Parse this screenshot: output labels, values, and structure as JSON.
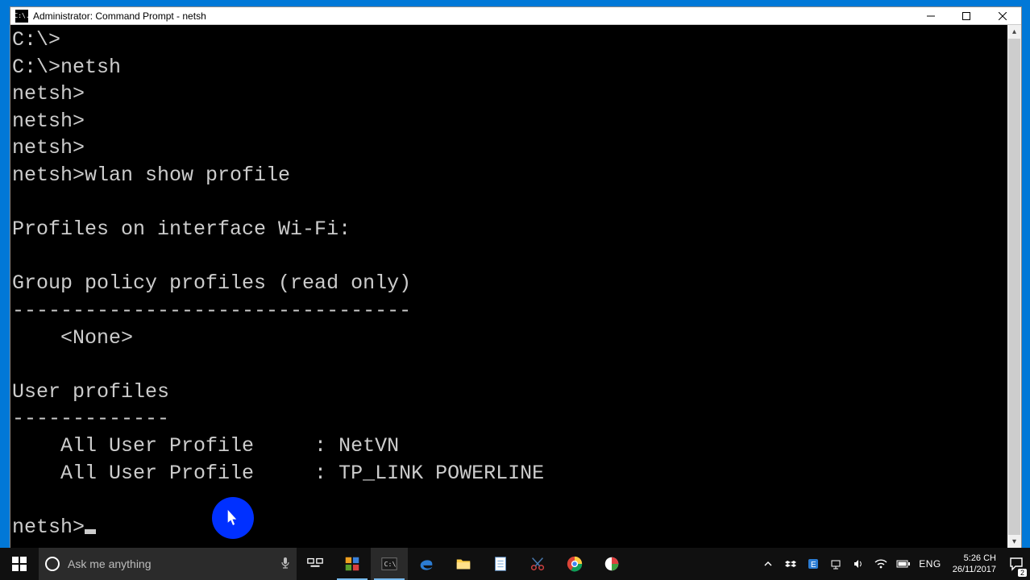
{
  "window": {
    "title": "Administrator: Command Prompt - netsh",
    "app_icon_text": "C:\\."
  },
  "terminal": {
    "lines": [
      "C:\\>",
      "C:\\>netsh",
      "netsh>",
      "netsh>",
      "netsh>",
      "netsh>wlan show profile",
      "",
      "Profiles on interface Wi-Fi:",
      "",
      "Group policy profiles (read only)",
      "---------------------------------",
      "    <None>",
      "",
      "User profiles",
      "-------------",
      "    All User Profile     : NetVN",
      "    All User Profile     : TP_LINK POWERLINE",
      ""
    ],
    "prompt": "netsh>"
  },
  "taskbar": {
    "search_placeholder": "Ask me anything",
    "tray": {
      "lang": "ENG",
      "time": "5:26 CH",
      "date": "26/11/2017",
      "notifications": "2"
    }
  }
}
